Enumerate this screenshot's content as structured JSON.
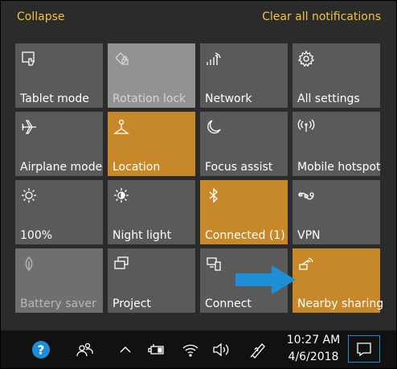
{
  "header": {
    "collapse_label": "Collapse",
    "clear_label": "Clear all notifications"
  },
  "tiles": [
    {
      "label": "Tablet mode",
      "icon": "tablet-mode-icon",
      "state": "off"
    },
    {
      "label": "Rotation lock",
      "icon": "rotation-lock-icon",
      "state": "disabled"
    },
    {
      "label": "Network",
      "icon": "network-icon",
      "state": "off"
    },
    {
      "label": "All settings",
      "icon": "gear-icon",
      "state": "off"
    },
    {
      "label": "Airplane mode",
      "icon": "airplane-icon",
      "state": "off"
    },
    {
      "label": "Location",
      "icon": "location-icon",
      "state": "on"
    },
    {
      "label": "Focus assist",
      "icon": "moon-icon",
      "state": "off"
    },
    {
      "label": "Mobile hotspot",
      "icon": "hotspot-icon",
      "state": "off"
    },
    {
      "label": "100%",
      "icon": "brightness-icon",
      "state": "off"
    },
    {
      "label": "Night light",
      "icon": "night-light-icon",
      "state": "off"
    },
    {
      "label": "Connected (1)",
      "icon": "bluetooth-icon",
      "state": "on"
    },
    {
      "label": "VPN",
      "icon": "vpn-icon",
      "state": "off"
    },
    {
      "label": "Battery saver",
      "icon": "battery-saver-icon",
      "state": "disabled"
    },
    {
      "label": "Project",
      "icon": "project-icon",
      "state": "off"
    },
    {
      "label": "Connect",
      "icon": "connect-icon",
      "state": "off"
    },
    {
      "label": "Nearby sharing",
      "icon": "nearby-sharing-icon",
      "state": "on"
    }
  ],
  "taskbar": {
    "time": "10:27 AM",
    "date": "4/6/2018",
    "icons": [
      "help-icon",
      "people-icon",
      "chevron-up-icon",
      "battery-icon",
      "wifi-icon",
      "volume-icon",
      "pen-icon",
      "action-center-icon"
    ]
  },
  "colors": {
    "accent": "#c7882a",
    "tile": "#5a5a5a",
    "link": "#f0c341",
    "arrow": "#1e8fd6"
  }
}
